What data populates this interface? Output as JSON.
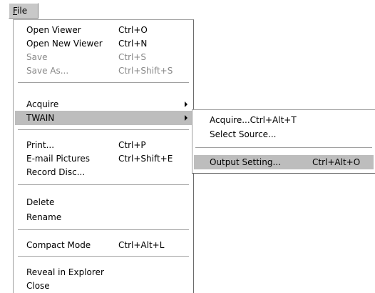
{
  "menubar": {
    "file": {
      "mnemonic": "F",
      "rest": "ile"
    }
  },
  "menu": {
    "open_viewer": {
      "label": "Open Viewer",
      "shortcut": "Ctrl+O"
    },
    "open_new_viewer": {
      "label": "Open New Viewer",
      "shortcut": "Ctrl+N"
    },
    "save": {
      "label": "Save",
      "shortcut": "Ctrl+S"
    },
    "save_as": {
      "label": "Save As...",
      "shortcut": "Ctrl+Shift+S"
    },
    "acquire": {
      "label": "Acquire"
    },
    "twain": {
      "label": "TWAIN"
    },
    "print": {
      "label": "Print...",
      "shortcut": "Ctrl+P"
    },
    "email_pictures": {
      "label": "E-mail Pictures",
      "shortcut": "Ctrl+Shift+E"
    },
    "record_disc": {
      "label": "Record Disc..."
    },
    "delete": {
      "label": "Delete"
    },
    "rename": {
      "label": "Rename"
    },
    "compact_mode": {
      "label": "Compact Mode",
      "shortcut": "Ctrl+Alt+L"
    },
    "reveal_in_explorer": {
      "label": "Reveal in Explorer"
    },
    "close": {
      "label": "Close"
    }
  },
  "submenu": {
    "acquire": {
      "label": "Acquire...Ctrl+Alt+T"
    },
    "select_source": {
      "label": "Select Source..."
    },
    "output_setting": {
      "label": "Output Setting...",
      "shortcut": "Ctrl+Alt+O"
    }
  }
}
